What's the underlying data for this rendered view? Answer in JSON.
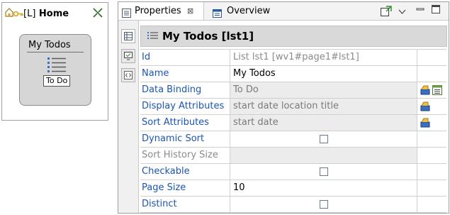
{
  "designer": {
    "home_prefix": "[L]",
    "home_title": "Home",
    "list_widget": {
      "title": "My Todos",
      "badge": "To Do"
    }
  },
  "tabs": [
    {
      "label": "Properties"
    },
    {
      "label": "Overview"
    }
  ],
  "header": {
    "title": "My Todos [lst1]"
  },
  "properties": [
    {
      "name": "Id",
      "value": "List lst1  [wv1#page1#lst1]",
      "kind": "readonly"
    },
    {
      "name": "Name",
      "value": "My Todos",
      "kind": "text"
    },
    {
      "name": "Data Binding",
      "value": "To Do",
      "kind": "readonly",
      "actions": [
        "binding-icon",
        "list-icon"
      ]
    },
    {
      "name": "Display Attributes",
      "value": "start date location title",
      "kind": "readonly",
      "actions": [
        "binding-icon"
      ]
    },
    {
      "name": "Sort Attributes",
      "value": "start date",
      "kind": "readonly",
      "actions": [
        "binding-icon"
      ]
    },
    {
      "name": "Dynamic Sort",
      "value": "",
      "kind": "checkbox",
      "checked": false
    },
    {
      "name": "Sort History Size",
      "value": "",
      "kind": "disabled"
    },
    {
      "name": "Checkable",
      "value": "",
      "kind": "checkbox",
      "checked": false
    },
    {
      "name": "Page Size",
      "value": "10",
      "kind": "text"
    },
    {
      "name": "Distinct",
      "value": "",
      "kind": "checkbox",
      "checked": false
    }
  ],
  "colors": {
    "link_blue": "#1a55b5",
    "header_gray": "#d9d9d9",
    "readonly_gray": "#ececec"
  }
}
